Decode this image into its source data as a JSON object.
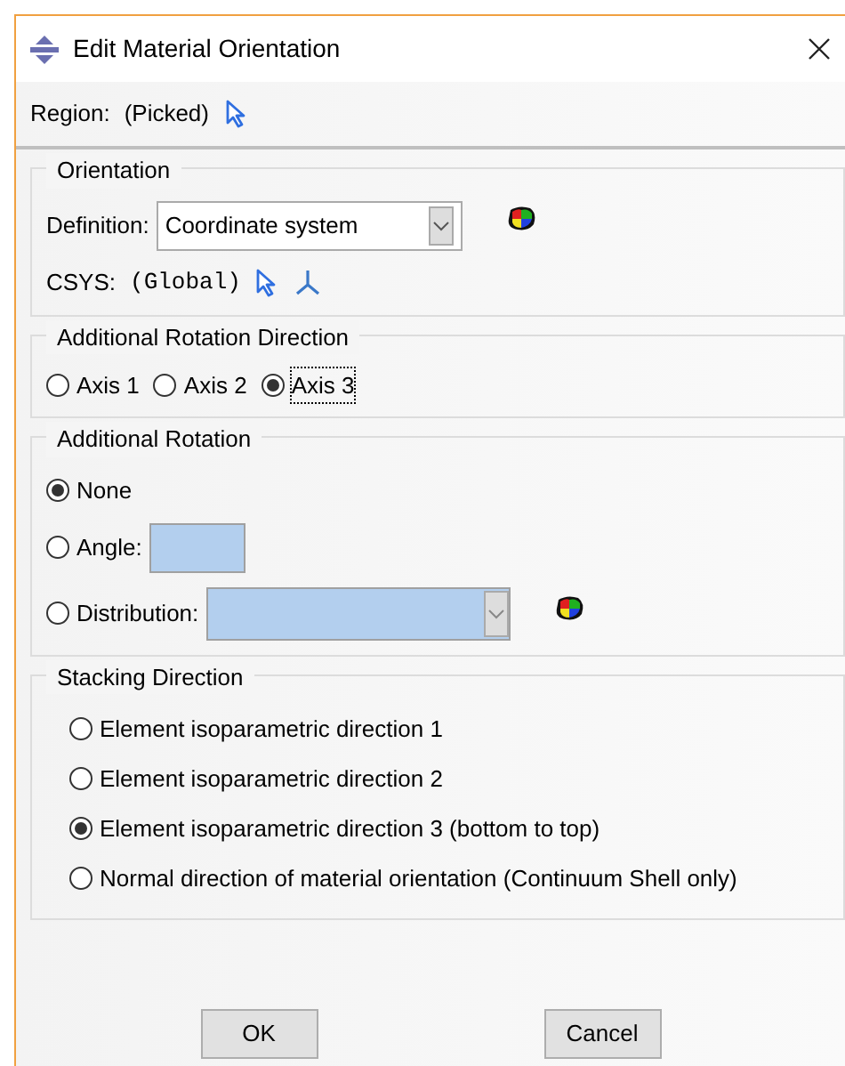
{
  "window": {
    "title": "Edit Material Orientation"
  },
  "region": {
    "label": "Region:",
    "value": "(Picked)"
  },
  "orientation": {
    "title": "Orientation",
    "definition": {
      "label": "Definition:",
      "value": "Coordinate system"
    },
    "csys": {
      "label": "CSYS:",
      "value": "(Global)"
    }
  },
  "additional_rotation_direction": {
    "title": "Additional Rotation Direction",
    "options": [
      {
        "label": "Axis 1",
        "selected": false,
        "focused": false
      },
      {
        "label": "Axis 2",
        "selected": false,
        "focused": false
      },
      {
        "label": "Axis 3",
        "selected": true,
        "focused": true
      }
    ]
  },
  "additional_rotation": {
    "title": "Additional Rotation",
    "options": [
      {
        "kind": "plain",
        "label": "None",
        "selected": true
      },
      {
        "kind": "field",
        "label": "Angle:",
        "selected": false
      },
      {
        "kind": "dropdown",
        "label": "Distribution:",
        "selected": false
      }
    ]
  },
  "stacking_direction": {
    "title": "Stacking Direction",
    "options": [
      {
        "label": "Element isoparametric direction 1",
        "selected": false
      },
      {
        "label": "Element isoparametric direction 2",
        "selected": false
      },
      {
        "label": "Element isoparametric direction 3 (bottom to top)",
        "selected": true
      },
      {
        "label": "Normal direction of material orientation (Continuum Shell only)",
        "selected": false
      }
    ]
  },
  "buttons": [
    "OK",
    "Cancel"
  ]
}
